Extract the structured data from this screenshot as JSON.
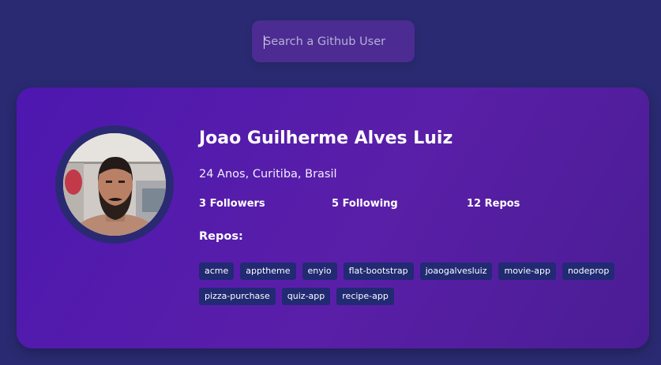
{
  "search": {
    "placeholder": "Search a Github User",
    "value": ""
  },
  "profile": {
    "name": "Joao Guilherme Alves Luiz",
    "bio": "24 Anos, Curitiba, Brasil",
    "followers": "3 Followers",
    "following": "5 Following",
    "repos_count": "12 Repos",
    "repos_heading": "Repos:",
    "repos": [
      "acme",
      "apptheme",
      "enyio",
      "flat-bootstrap",
      "joaogalvesluiz",
      "movie-app",
      "nodeprop",
      "pizza-purchase",
      "quiz-app",
      "recipe-app"
    ]
  },
  "colors": {
    "background": "#2a2a72",
    "card": "#5318ac",
    "search": "#4c2c92",
    "tag": "#212a72"
  }
}
